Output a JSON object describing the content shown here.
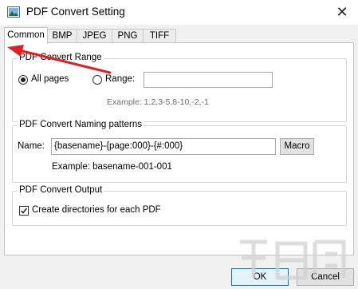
{
  "window": {
    "title": "PDF Convert Setting",
    "close_glyph": "✕"
  },
  "tabs": [
    {
      "label": "Common",
      "active": true
    },
    {
      "label": "BMP"
    },
    {
      "label": "JPEG"
    },
    {
      "label": "PNG"
    },
    {
      "label": "TIFF"
    }
  ],
  "range_group": {
    "title": "PDF Convert Range",
    "all_pages_label": "All pages",
    "range_label": "Range:",
    "range_value": "",
    "example": "Example: 1,2,3-5,8-10,-2,-1",
    "selected": "all_pages"
  },
  "naming_group": {
    "title": "PDF Convert Naming patterns",
    "name_label": "Name:",
    "name_value": "{basename}-{page:000}-{#:000}",
    "macro_label": "Macro",
    "example": "Example:  basename-001-001"
  },
  "output_group": {
    "title": "PDF Convert Output",
    "create_dirs_label": "Create directories for each PDF",
    "create_dirs_checked": true
  },
  "footer": {
    "ok_label": "OK",
    "cancel_label": "Cancel"
  },
  "annotation": {
    "arrow_color": "#e02020"
  }
}
